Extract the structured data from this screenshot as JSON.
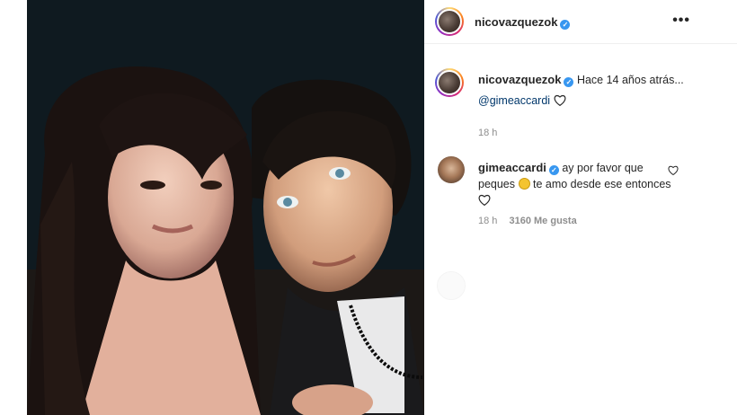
{
  "post": {
    "author": "nicovazquezok",
    "caption_text": "Hace 14 años atrás...",
    "caption_mention": "@gimeaccardi",
    "caption_time": "18 h"
  },
  "comment": {
    "author": "gimeaccardi",
    "text_part1": "ay por favor que peques",
    "text_part2": "te amo desde ese entonces",
    "time": "18 h",
    "likes": "3160 Me gusta"
  },
  "icons": {
    "verified": "verified-badge-icon",
    "more": "more-options-icon",
    "heart": "heart-outline-icon",
    "emoji": "pleading-face-emoji"
  },
  "colors": {
    "verified": "#3897f0",
    "mention": "#00376b",
    "meta": "#8e8e8e"
  }
}
